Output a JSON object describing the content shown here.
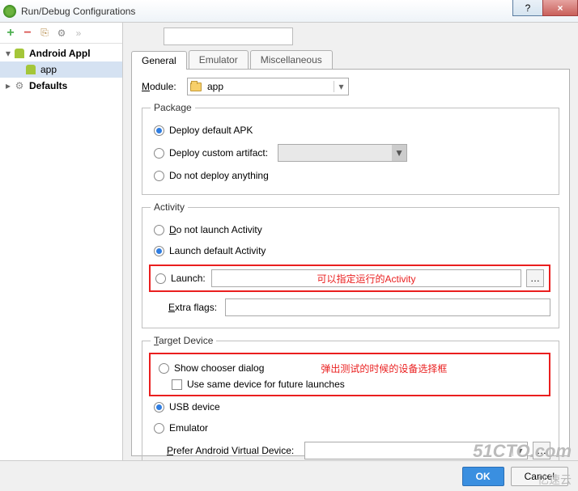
{
  "window": {
    "title": "Run/Debug Configurations"
  },
  "tree": {
    "android_app": "Android Appl",
    "app": "app",
    "defaults": "Defaults"
  },
  "tabs": {
    "general": "General",
    "emulator": "Emulator",
    "misc": "Miscellaneous"
  },
  "module": {
    "label": "Module:",
    "value": "app"
  },
  "package": {
    "legend": "Package",
    "deploy_default": "Deploy default APK",
    "deploy_custom": "Deploy custom artifact:",
    "no_deploy": "Do not deploy anything"
  },
  "activity": {
    "legend": "Activity",
    "no_launch": "Do not launch Activity",
    "launch_default": "Launch default Activity",
    "launch": "Launch:",
    "annotation1": "可以指定运行的Activity",
    "extra_flags": "Extra flags:"
  },
  "target": {
    "legend": "Target Device",
    "show_chooser": "Show chooser dialog",
    "use_same": "Use same device for future launches",
    "annotation2": "弹出测试的时候的设备选择框",
    "usb": "USB device",
    "emulator": "Emulator",
    "prefer_avd": "Prefer Android Virtual Device:"
  },
  "buttons": {
    "ok": "OK",
    "cancel": "Cancel"
  },
  "watermark": {
    "main": "51CTO.com",
    "sub": "亿速云"
  }
}
